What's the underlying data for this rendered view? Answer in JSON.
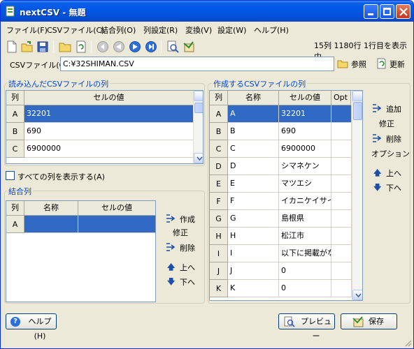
{
  "window": {
    "title": "nextCSV - 無題"
  },
  "menu": {
    "items": [
      "ファイル(F)",
      "CSVファイル(C)",
      "結合列(O)",
      "列設定(R)",
      "変換(V)",
      "設定(W)",
      "ヘルプ(H)"
    ]
  },
  "status_text": "15列 1180行 1行目を表示中",
  "csv_file": {
    "label": "CSVファイル(C)",
    "value": "C:¥32SHIMAN.CSV",
    "browse_label": "参照",
    "refresh_label": "更新"
  },
  "loaded_columns": {
    "title": "読み込んだCSVファイルの列",
    "headers": {
      "col": "列",
      "value": "セルの値"
    },
    "rows": [
      {
        "col": "A",
        "value": "32201"
      },
      {
        "col": "B",
        "value": "690"
      },
      {
        "col": "C",
        "value": "6900000"
      }
    ],
    "show_all_label": "すべての列を表示する(A)"
  },
  "joined_columns": {
    "title": "結合列",
    "headers": {
      "col": "列",
      "name": "名称",
      "value": "セルの値"
    },
    "rows": [
      {
        "col": "A",
        "name": "",
        "value": ""
      }
    ],
    "create_label": "作成",
    "modify_label": "修正",
    "delete_label": "削除",
    "up_label": "上へ",
    "down_label": "下へ"
  },
  "output_columns": {
    "title": "作成するCSVファイルの列",
    "headers": {
      "col": "列",
      "name": "名称",
      "value": "セルの値",
      "opt": "Opt"
    },
    "rows": [
      {
        "col": "A",
        "name": "A",
        "value": "32201"
      },
      {
        "col": "B",
        "name": "B",
        "value": "690"
      },
      {
        "col": "C",
        "name": "C",
        "value": "6900000"
      },
      {
        "col": "D",
        "name": "D",
        "value": "シマネケン"
      },
      {
        "col": "E",
        "name": "E",
        "value": "マツエシ"
      },
      {
        "col": "F",
        "name": "F",
        "value": "イカニケイサイガナ"
      },
      {
        "col": "G",
        "name": "G",
        "value": "島根県"
      },
      {
        "col": "H",
        "name": "H",
        "value": "松江市"
      },
      {
        "col": "I",
        "name": "I",
        "value": "以下に掲載がな"
      },
      {
        "col": "J",
        "name": "J",
        "value": "0"
      },
      {
        "col": "K",
        "name": "K",
        "value": "0"
      }
    ],
    "add_label": "追加",
    "modify_label": "修正",
    "delete_label": "削除",
    "option_label": "オプション",
    "up_label": "上へ",
    "down_label": "下へ"
  },
  "buttons": {
    "help": "ヘルプ(H)",
    "preview": "プレビュー",
    "save": "保存"
  },
  "colors": {
    "selection": "#316ac5",
    "title_bar": "#0058e6",
    "group_title": "#0046d5"
  }
}
